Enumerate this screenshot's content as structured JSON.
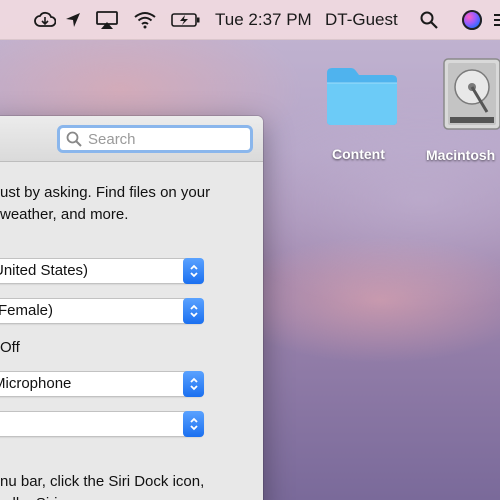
{
  "menubar": {
    "icons": [
      "creative-cloud-icon",
      "location-arrow-icon",
      "airplay-icon",
      "wifi-icon",
      "battery-charging-icon"
    ],
    "clock": "Tue 2:37 PM",
    "user": "DT-Guest",
    "search_icon": "spotlight-search-icon",
    "siri_icon": "siri-icon"
  },
  "desktop": {
    "items": [
      {
        "label": "Content",
        "icon": "folder-icon"
      },
      {
        "label": "Macintosh",
        "icon": "hard-drive-icon"
      }
    ]
  },
  "siri_window": {
    "search": {
      "placeholder": "Search",
      "value": ""
    },
    "description": "ust by asking. Find files on your\nweather, and more.",
    "language": "United States)",
    "voice": " (Female)",
    "voice_feedback": "Off",
    "mic_input": "Microphone",
    "shortcut": "",
    "footer": "nu bar, click the Siri Dock icon,\n  ...ll ...Siri..."
  },
  "colors": {
    "accent": "#1a6ff0",
    "search_focus_ring": "#8ab6ec",
    "folder": "#5ec3f4",
    "menubar_bg": "#f2dce0"
  }
}
